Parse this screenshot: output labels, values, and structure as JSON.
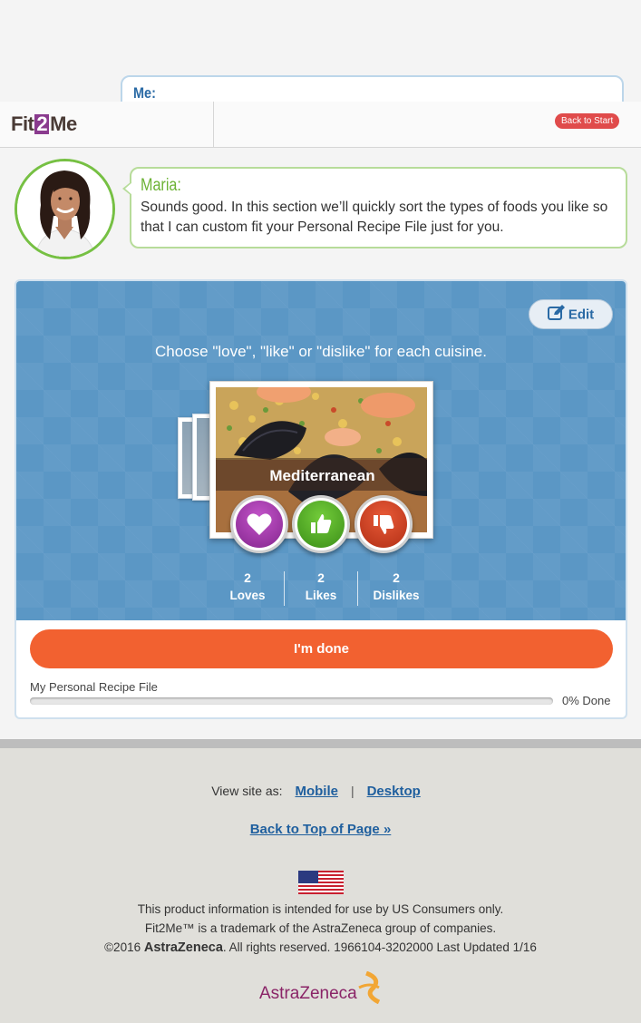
{
  "chat": {
    "me_label": "Me:",
    "maria_name": "Maria:",
    "maria_text": "Sounds good. In this section we’ll quickly sort the types of foods you like so that I can custom fit your Personal Recipe File just for you."
  },
  "header": {
    "logo_left": "Fit",
    "logo_mid": "2",
    "logo_right": "Me",
    "back_to_start": "Back to Start"
  },
  "sorter": {
    "edit_label": "Edit",
    "instruction": "Choose \"love\", \"like\" or \"dislike\" for each cuisine.",
    "current_cuisine": "Mediterranean",
    "stats": [
      {
        "count": "2",
        "label": "Loves"
      },
      {
        "count": "2",
        "label": "Likes"
      },
      {
        "count": "2",
        "label": "Dislikes"
      }
    ],
    "done_label": "I'm done",
    "progress_label": "My Personal Recipe File",
    "progress_text": "0% Done",
    "progress_value": 0
  },
  "footer": {
    "view_site_as": "View site as:",
    "mobile": "Mobile",
    "separator": "|",
    "desktop": "Desktop",
    "back_to_top": "Back to Top of Page »",
    "legal_1": "This product information is intended for use by US Consumers only.",
    "legal_2": "Fit2Me™ is a trademark of the AstraZeneca group of companies.",
    "legal_3a": "©2016 ",
    "legal_3b": "AstraZeneca",
    "legal_3c": ". All rights reserved. 1966104-3202000 Last Updated 1/16",
    "brand_logo": "AstraZeneca"
  },
  "colors": {
    "brand_purple": "#8a3b8e",
    "maria_green": "#6cb234",
    "card_blue": "#5b97c5",
    "done_orange": "#f26130",
    "link_blue": "#1f5f9e"
  },
  "icons": [
    "edit-icon",
    "heart-icon",
    "thumbs-up-icon",
    "thumbs-down-icon",
    "us-flag-icon"
  ]
}
